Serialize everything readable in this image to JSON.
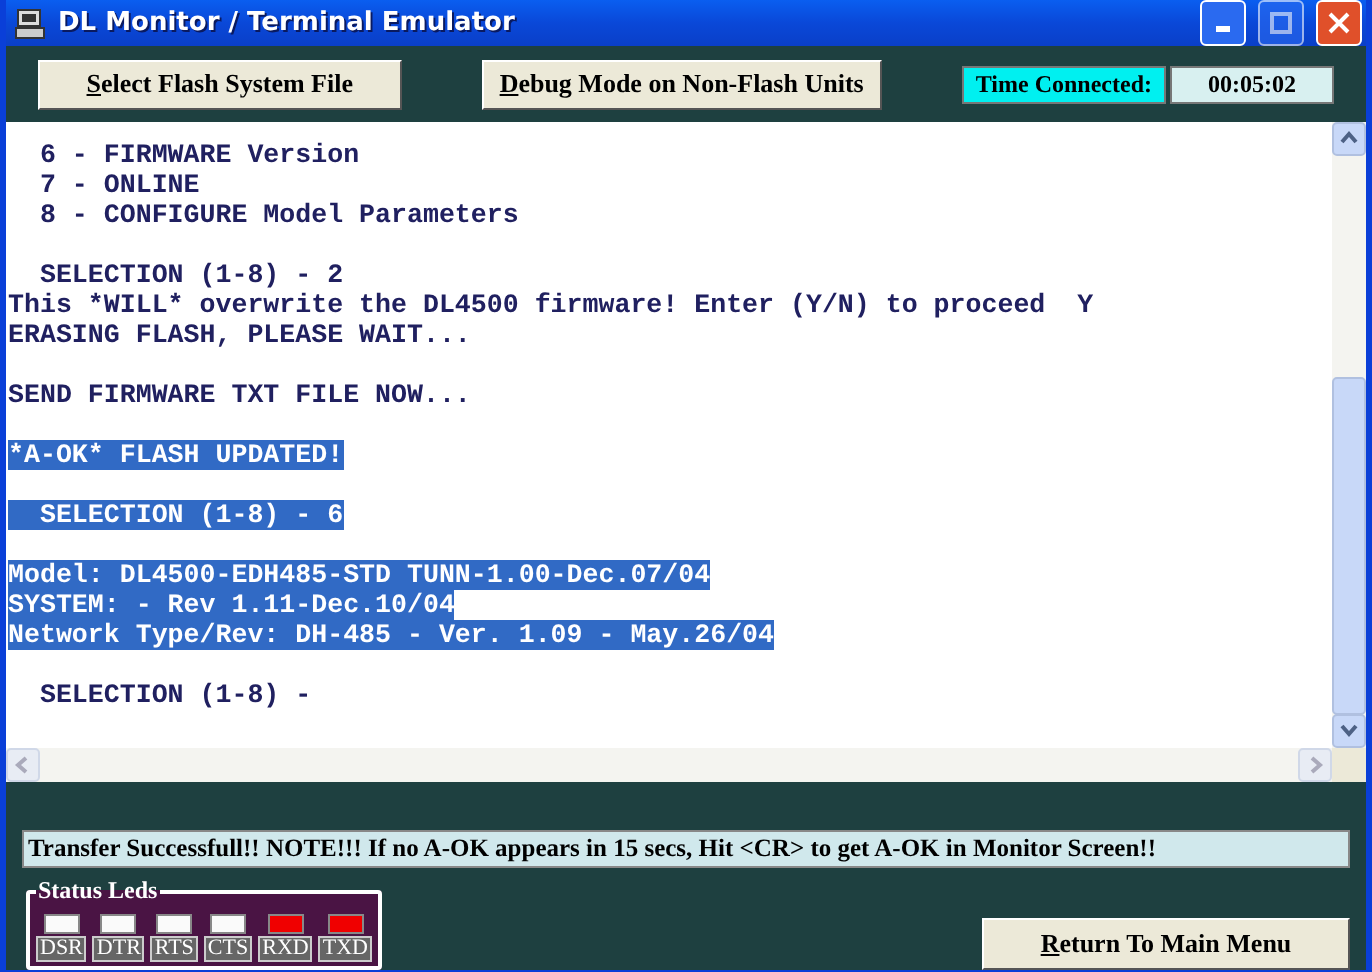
{
  "window": {
    "title": "DL Monitor / Terminal Emulator"
  },
  "toolbar": {
    "buttons": [
      {
        "accel": "S",
        "rest": "elect Flash System File"
      },
      {
        "accel": "D",
        "rest": "ebug Mode on Non-Flash Units"
      }
    ],
    "time_label": "Time Connected:",
    "time_value": "00:05:02"
  },
  "terminal": {
    "paragraphs": [
      [
        {
          "text": "  6 - FIRMWARE Version",
          "selected": false
        },
        {
          "text": "  7 - ONLINE",
          "selected": false
        },
        {
          "text": "  8 - CONFIGURE Model Parameters",
          "selected": false
        }
      ],
      [
        {
          "text": "  SELECTION (1-8) - 2",
          "selected": false
        },
        {
          "text": "This *WILL* overwrite the DL4500 firmware! Enter (Y/N) to proceed  Y",
          "selected": false
        },
        {
          "text": "ERASING FLASH, PLEASE WAIT...",
          "selected": false
        }
      ],
      [
        {
          "text": "SEND FIRMWARE TXT FILE NOW...",
          "selected": false
        }
      ],
      [
        {
          "text": "*A-OK* FLASH UPDATED!",
          "selected": true
        }
      ],
      [
        {
          "text": "  SELECTION (1-8) - 6",
          "selected": true
        }
      ],
      [
        {
          "text": "Model: DL4500-EDH485-STD TUNN-1.00-Dec.07/04",
          "selected": true
        },
        {
          "text": "SYSTEM: - Rev 1.11-Dec.10/04",
          "selected": true
        },
        {
          "text": "Network Type/Rev: DH-485 - Ver. 1.09 - May.26/04",
          "selected": true
        }
      ],
      [
        {
          "text": "  SELECTION (1-8) -",
          "selected": false
        }
      ]
    ]
  },
  "status_message": "Transfer Successfull!!  NOTE!!! If no A-OK appears in 15 secs, Hit <CR> to get A-OK in Monitor Screen!!",
  "status_leds": {
    "title": "Status Leds",
    "leds": [
      {
        "label": "DSR",
        "lit": false
      },
      {
        "label": "DTR",
        "lit": false
      },
      {
        "label": "RTS",
        "lit": false
      },
      {
        "label": "CTS",
        "lit": false
      },
      {
        "label": "RXD",
        "lit": true
      },
      {
        "label": "TXD",
        "lit": true
      }
    ]
  },
  "return_button": {
    "accel": "R",
    "rest": "eturn To Main Menu"
  }
}
